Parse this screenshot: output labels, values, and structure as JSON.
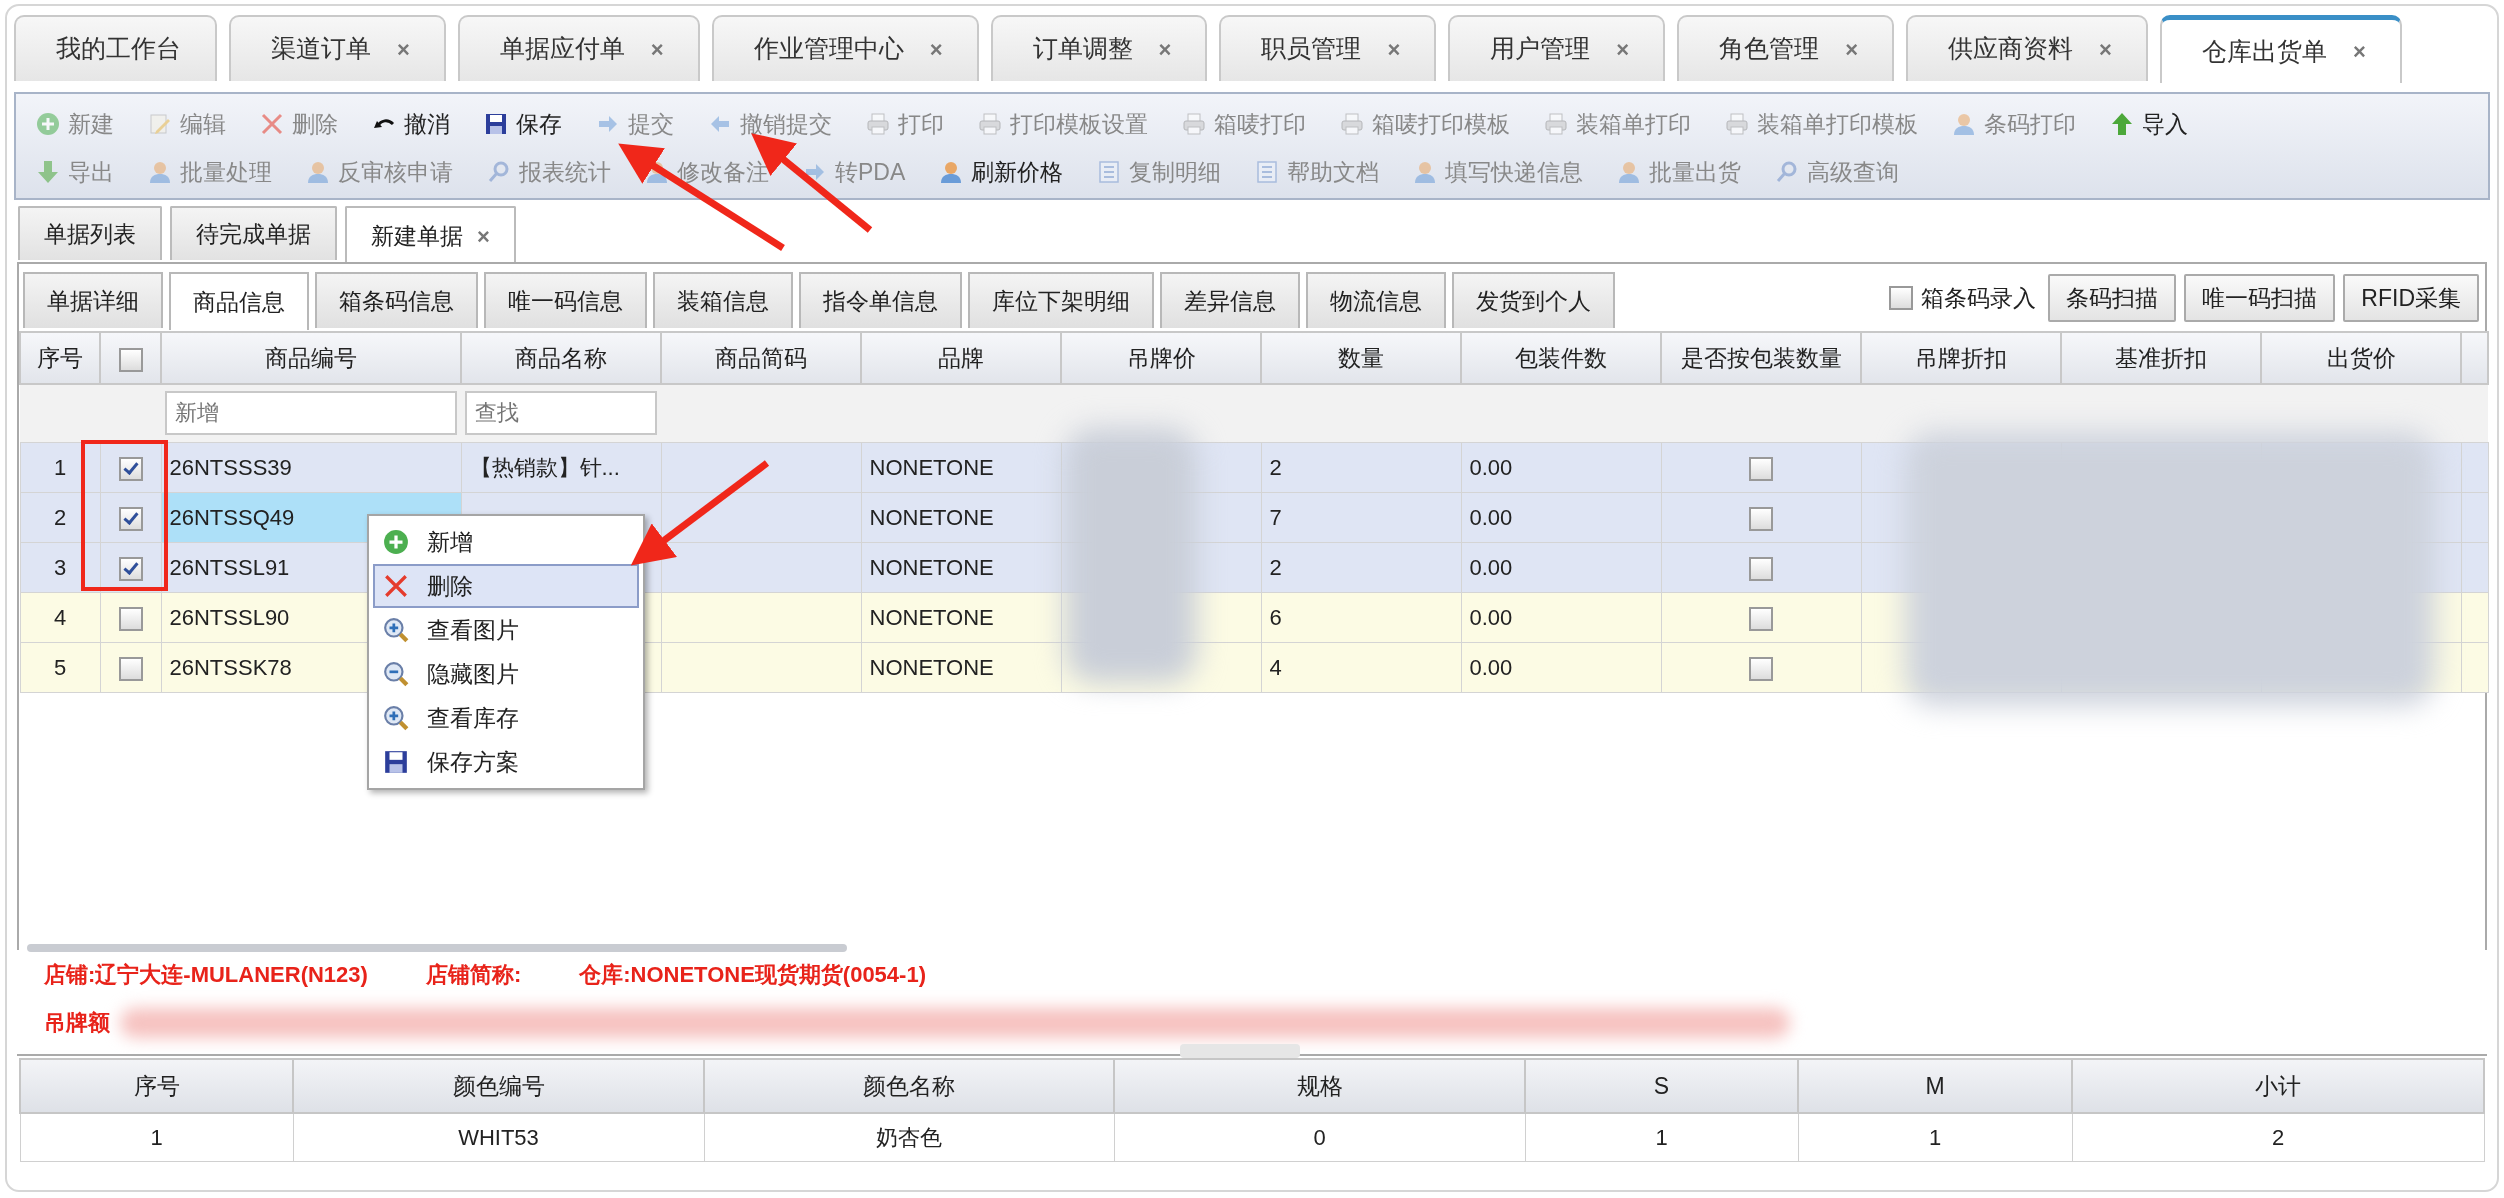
{
  "top_tabs": [
    {
      "label": "我的工作台",
      "selected": false
    },
    {
      "label": "渠道订单",
      "close": "×",
      "selected": false
    },
    {
      "label": "单据应付单",
      "close": "×",
      "selected": false
    },
    {
      "label": "作业管理中心",
      "close": "×",
      "selected": false
    },
    {
      "label": "订单调整",
      "close": "×",
      "selected": false
    },
    {
      "label": "职员管理",
      "close": "×",
      "selected": false
    },
    {
      "label": "用户管理",
      "close": "×",
      "selected": false
    },
    {
      "label": "角色管理",
      "close": "×",
      "selected": false
    },
    {
      "label": "供应商资料",
      "close": "×",
      "selected": false
    },
    {
      "label": "仓库出货单",
      "close": "×",
      "selected": true
    }
  ],
  "toolbar": {
    "rows": [
      {
        "items": [
          {
            "label": "新建",
            "disabled": true
          },
          {
            "label": "编辑",
            "disabled": true
          },
          {
            "label": "删除",
            "disabled": true
          },
          {
            "label": "撤消",
            "disabled": false
          },
          {
            "label": "保存",
            "disabled": false
          },
          {
            "label": "提交",
            "disabled": true
          },
          {
            "label": "撤销提交",
            "disabled": true
          },
          {
            "label": "打印",
            "disabled": true
          },
          {
            "label": "打印模板设置",
            "disabled": true
          },
          {
            "label": "箱唛打印",
            "disabled": true
          },
          {
            "label": "箱唛打印模板",
            "disabled": true
          },
          {
            "label": "装箱单打印",
            "disabled": true
          },
          {
            "label": "装箱单打印模板",
            "disabled": true
          },
          {
            "label": "条码打印",
            "disabled": true
          },
          {
            "label": "导入",
            "disabled": false
          }
        ]
      },
      {
        "items": [
          {
            "label": "导出",
            "disabled": true
          },
          {
            "label": "批量处理",
            "disabled": true
          },
          {
            "label": "反审核申请",
            "disabled": true
          },
          {
            "label": "报表统计",
            "disabled": true
          },
          {
            "label": "修改备注",
            "disabled": true
          },
          {
            "label": "转PDA",
            "disabled": true
          },
          {
            "label": "刷新价格",
            "disabled": false
          },
          {
            "label": "复制明细",
            "disabled": true
          },
          {
            "label": "帮助文档",
            "disabled": true
          },
          {
            "label": "填写快递信息",
            "disabled": true
          },
          {
            "label": "批量出货",
            "disabled": true
          },
          {
            "label": "高级查询",
            "disabled": true
          }
        ]
      }
    ]
  },
  "sub_tabs": [
    {
      "label": "单据列表",
      "selected": false
    },
    {
      "label": "待完成单据",
      "selected": false
    },
    {
      "label": "新建单据",
      "close": "×",
      "selected": true
    }
  ],
  "detail_tabs": [
    {
      "label": "单据详细",
      "selected": false
    },
    {
      "label": "商品信息",
      "selected": true
    },
    {
      "label": "箱条码信息",
      "selected": false
    },
    {
      "label": "唯一码信息",
      "selected": false
    },
    {
      "label": "装箱信息",
      "selected": false
    },
    {
      "label": "指令单信息",
      "selected": false
    },
    {
      "label": "库位下架明细",
      "selected": false
    },
    {
      "label": "差异信息",
      "selected": false
    },
    {
      "label": "物流信息",
      "selected": false
    },
    {
      "label": "发货到个人",
      "selected": false
    }
  ],
  "scan_options": {
    "checkbox": {
      "label": "箱条码录入",
      "checked": false
    },
    "buttons": [
      "条码扫描",
      "唯一码扫描",
      "RFID采集"
    ]
  },
  "grid": {
    "columns": [
      "序号",
      "",
      "商品编号",
      "商品名称",
      "商品简码",
      "品牌",
      "吊牌价",
      "数量",
      "包装件数",
      "是否按包装数量",
      "吊牌折扣",
      "基准折扣",
      "出货价"
    ],
    "header_checked": false,
    "filter": {
      "code_placeholder": "新增",
      "name_placeholder": "查找"
    },
    "rows": [
      {
        "index": "1",
        "checked": true,
        "selected": true,
        "editing": false,
        "code": "26NTSSS39",
        "name": "【热销款】针...",
        "brand": "NONETONE",
        "qty": "2",
        "pack_count": "0.00",
        "by_pack": false
      },
      {
        "index": "2",
        "checked": true,
        "selected": true,
        "editing": true,
        "code": "26NTSSQ49",
        "brand": "NONETONE",
        "qty": "7",
        "pack_count": "0.00",
        "by_pack": false
      },
      {
        "index": "3",
        "checked": true,
        "selected": true,
        "editing": false,
        "code": "26NTSSL91",
        "brand": "NONETONE",
        "qty": "2",
        "pack_count": "0.00",
        "by_pack": false
      },
      {
        "index": "4",
        "checked": false,
        "selected": false,
        "editing": false,
        "code": "26NTSSL90",
        "brand": "NONETONE",
        "qty": "6",
        "pack_count": "0.00",
        "by_pack": false
      },
      {
        "index": "5",
        "checked": false,
        "selected": false,
        "editing": false,
        "code": "26NTSSK78",
        "brand": "NONETONE",
        "qty": "4",
        "pack_count": "0.00",
        "by_pack": false
      }
    ]
  },
  "context_menu": [
    {
      "label": "新增",
      "selected": false
    },
    {
      "label": "删除",
      "selected": true
    },
    {
      "label": "查看图片",
      "selected": false
    },
    {
      "label": "隐藏图片",
      "selected": false
    },
    {
      "label": "查看库存",
      "selected": false
    },
    {
      "label": "保存方案",
      "selected": false
    }
  ],
  "info": {
    "store": "店铺:辽宁大连-MULANER(N123)",
    "store_short": "店铺简称:",
    "warehouse": "仓库:NONETONE现货期货(0054-1)",
    "tag_amount": "吊牌额"
  },
  "size_table": {
    "columns": [
      "序号",
      "颜色编号",
      "颜色名称",
      "规格",
      "S",
      "M",
      "小计"
    ],
    "rows": [
      [
        "1",
        "WHIT53",
        "奶杏色",
        "0",
        "1",
        "1",
        "2"
      ]
    ]
  }
}
